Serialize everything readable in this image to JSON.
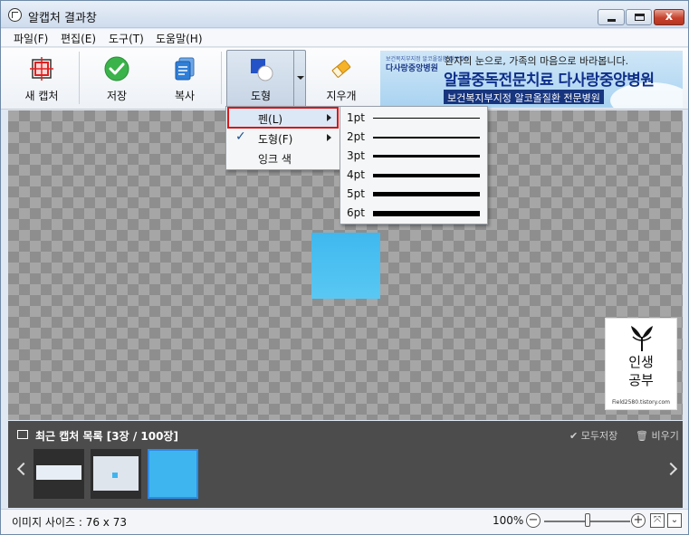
{
  "window": {
    "title": "알캡처 결과창",
    "minimize_label": "",
    "maximize_label": "",
    "close_label": "x"
  },
  "menubar": [
    {
      "label": "파일(F)"
    },
    {
      "label": "편집(E)"
    },
    {
      "label": "도구(T)"
    },
    {
      "label": "도움말(H)"
    }
  ],
  "toolbar": {
    "new_capture": "새 캡처",
    "save": "저장",
    "copy": "복사",
    "shape": "도형",
    "eraser": "지우개"
  },
  "ad": {
    "logo": "다사랑중앙병원",
    "logo_small": "보건복지부지정 알코올질환 전문병원",
    "line1": "환자의 눈으로, 가족의 마음으로 바라봅니다.",
    "line2": "알콜중독전문치료 다사랑중앙병원",
    "line3": "보건복지부지정 알코올질환 전문병원"
  },
  "shape_menu": {
    "items": [
      {
        "label": "펜(L)",
        "has_submenu": true,
        "checked": false,
        "highlighted": true
      },
      {
        "label": "도형(F)",
        "has_submenu": true,
        "checked": true,
        "highlighted": false
      },
      {
        "label": "잉크 색",
        "has_submenu": false,
        "checked": false,
        "highlighted": false
      }
    ]
  },
  "pen_menu": {
    "items": [
      {
        "label": "1pt",
        "width": 1
      },
      {
        "label": "2pt",
        "width": 2
      },
      {
        "label": "3pt",
        "width": 3
      },
      {
        "label": "4pt",
        "width": 4
      },
      {
        "label": "5pt",
        "width": 5
      },
      {
        "label": "6pt",
        "width": 6
      }
    ]
  },
  "watermark": {
    "text_line1": "인생",
    "text_line2": "공부",
    "url": "Field2580.tistory.com"
  },
  "recent": {
    "title": "최근 캡처 목록 [3장 / 100장]",
    "save_all": "모두저장",
    "clear": "비우기"
  },
  "status": {
    "image_size": "이미지 사이즈 : 76 x 73",
    "zoom": "100%",
    "zoom_level_fraction": 0.5
  },
  "colors": {
    "accent": "#2d8ae6",
    "capture_blue": "#3fb8ef",
    "highlight_border": "#d61818"
  }
}
